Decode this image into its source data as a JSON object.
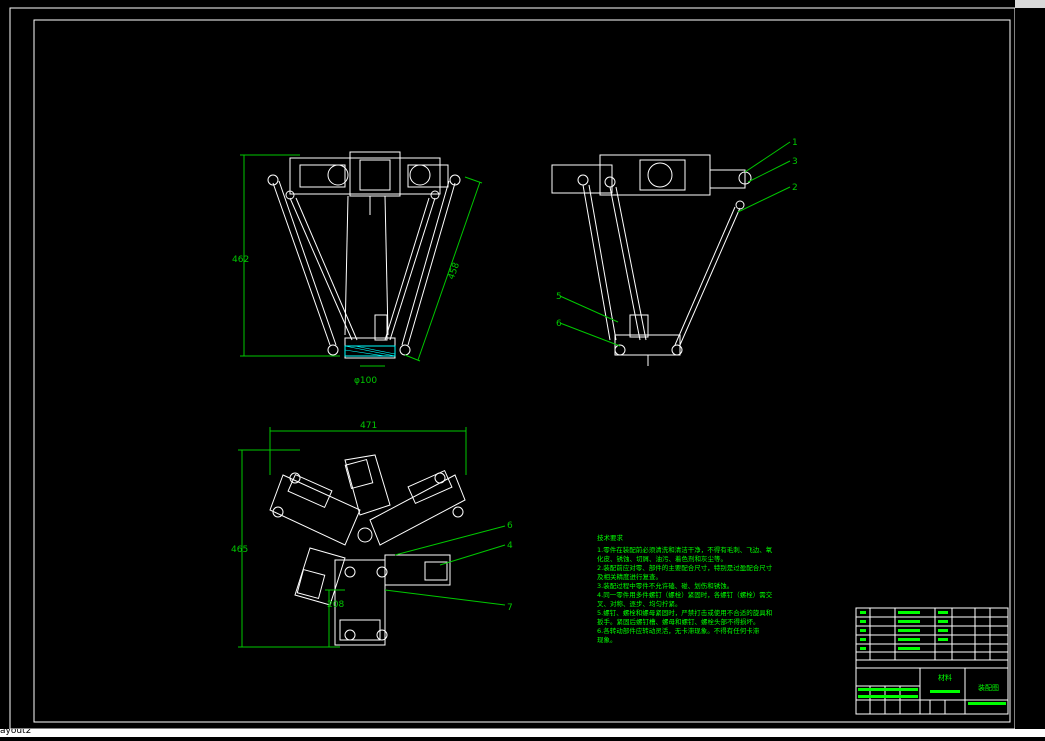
{
  "layout_tab": {
    "label": "ayout2"
  },
  "dimensions": {
    "front_height": "462",
    "front_arm": "458",
    "front_diameter": "φ100",
    "top_width": "471",
    "top_height": "465",
    "top_offset": "208"
  },
  "part_numbers": [
    "1",
    "3",
    "2",
    "5",
    "6",
    "6",
    "4",
    "7"
  ],
  "tech_requirements": {
    "title": "技术要求",
    "lines": [
      "1.零件在装配前必须清洗和清洁干净，不得有毛刺、飞边、氧",
      "化皮、锈蚀、切屑、油污、着色剂和灰尘等。",
      "2.装配前应对零、部件的主要配合尺寸，特别是过盈配合尺寸",
      "及相关精度进行复查。",
      "3.装配过程中零件不允许磕、碰、划伤和锈蚀。",
      "4.同一零件用多件螺钉（螺栓）紧固时，各螺钉（螺栓）需交",
      "叉、对称、逐步、均匀拧紧。",
      "5.螺钉、螺栓和螺母紧固时，严禁打击或使用不合适的旋具和",
      "扳手。紧固后螺钉槽、螺母和螺钉、螺栓头部不得损坏。",
      "6.各转动部件应转动灵活，无卡滞现象。不得有任何卡滞",
      "现象。"
    ]
  },
  "title_block": {
    "drawing_title": "装配图",
    "material_label": "材料"
  },
  "colors": {
    "background": "#000000",
    "outline": "#ffffff",
    "dimension": "#00c800",
    "text_green": "#00ff00",
    "cyan": "#00ffff"
  }
}
